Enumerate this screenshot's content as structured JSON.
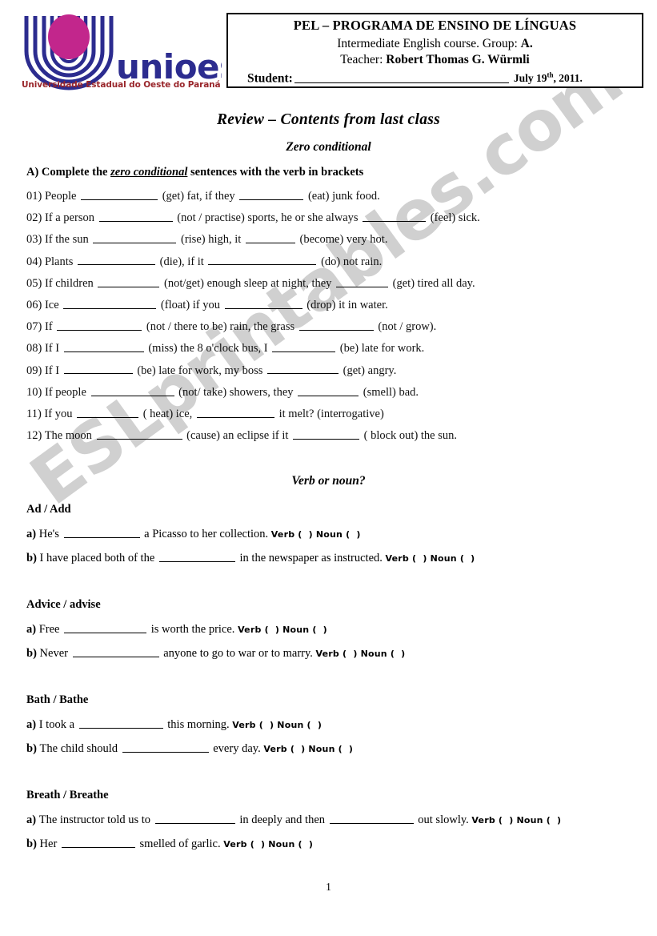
{
  "logo": {
    "wordmark": "unioeste",
    "subtitle": "Universidade Estadual do Oeste do Paraná",
    "colors": {
      "arcs": "#2c2c8f",
      "ellipse": "#c2268c",
      "wordmark": "#2c2c8f",
      "subtitle": "#99262b"
    }
  },
  "header": {
    "line1": "PEL – PROGRAMA DE ENSINO DE LÍNGUAS",
    "line2_prefix": "Intermediate English course. Group:",
    "line2_group": "A.",
    "line3_prefix": "Teacher:",
    "line3_name": "Robert Thomas G. Würmli",
    "student_label": "Student:",
    "date_prefix": "July 19",
    "date_sup": "th",
    "date_suffix": ", 2011."
  },
  "titles": {
    "main": "Review – Contents from last class",
    "sub": "Zero conditional",
    "verb_or_noun": "Verb or noun?"
  },
  "instruction": {
    "before": "A) Complete the ",
    "emphasis": "zero conditional",
    "after": " sentences with the verb in brackets"
  },
  "zero_conditional": [
    {
      "num": "01)",
      "parts": [
        "People",
        "(get) fat, if they",
        "(eat) junk food."
      ],
      "blanks": [
        96,
        80
      ]
    },
    {
      "num": "02)",
      "parts": [
        "If a person",
        "(not / practise) sports, he or she always",
        "(feel) sick."
      ],
      "blanks": [
        92,
        79
      ]
    },
    {
      "num": "03)",
      "parts": [
        "If the sun",
        "(rise) high, it",
        "(become) very hot."
      ],
      "blanks": [
        104,
        62
      ]
    },
    {
      "num": "04)",
      "parts": [
        "Plants",
        "(die), if it",
        "(do) not rain."
      ],
      "blanks": [
        97,
        135
      ]
    },
    {
      "num": "05)",
      "parts": [
        "If children",
        "(not/get) enough sleep at night, they",
        "(get) tired all day."
      ],
      "blanks": [
        77,
        65
      ]
    },
    {
      "num": "06)",
      "parts": [
        "Ice",
        "(float) if you",
        "(drop) it in water."
      ],
      "blanks": [
        116,
        97
      ]
    },
    {
      "num": "07)",
      "parts": [
        "If",
        "(not / there to be) rain, the grass",
        "(not / grow)."
      ],
      "blanks": [
        106,
        93
      ]
    },
    {
      "num": "08)",
      "parts": [
        "If I",
        "(miss) the 8 o'clock bus, I",
        "(be) late for work."
      ],
      "blanks": [
        100,
        79
      ]
    },
    {
      "num": "09)",
      "parts": [
        "If I",
        "(be) late for work, my boss",
        "(get) angry."
      ],
      "blanks": [
        86,
        89
      ]
    },
    {
      "num": "10)",
      "parts": [
        "If   people",
        "(not/ take) showers, they",
        "(smell) bad."
      ],
      "blanks": [
        104,
        76
      ]
    },
    {
      "num": "11)",
      "parts": [
        "If you",
        "( heat) ice,",
        "it melt? (interrogative)"
      ],
      "blanks": [
        77,
        97
      ]
    },
    {
      "num": "12)",
      "parts": [
        "The moon",
        "(cause) an eclipse if it",
        "( block out) the sun."
      ],
      "blanks": [
        107,
        83
      ]
    }
  ],
  "verb_or_noun": {
    "tag_verb": "Verb (",
    "tag_verb_close": ") Noun (",
    "tag_close": ")",
    "groups": [
      {
        "heading": "Ad / Add",
        "items": [
          {
            "bullet": "a)",
            "parts": [
              "He's",
              "a Picasso to her collection."
            ],
            "blanks": [
              95
            ]
          },
          {
            "bullet": "b)",
            "parts": [
              "I have placed both of the",
              "in the newspaper as instructed."
            ],
            "blanks": [
              95
            ]
          }
        ]
      },
      {
        "heading": "Advice / advise",
        "items": [
          {
            "bullet": "a)",
            "parts": [
              "Free",
              "is worth the price."
            ],
            "blanks": [
              103
            ]
          },
          {
            "bullet": "b)",
            "parts": [
              "Never",
              "anyone to go to war or to marry."
            ],
            "blanks": [
              108
            ]
          }
        ]
      },
      {
        "heading": "Bath / Bathe",
        "items": [
          {
            "bullet": "a)",
            "parts": [
              "I took a",
              "this morning."
            ],
            "blanks": [
              105
            ]
          },
          {
            "bullet": "b)",
            "parts": [
              "The child should",
              "every day."
            ],
            "blanks": [
              108
            ]
          }
        ]
      },
      {
        "heading": "Breath / Breathe",
        "items": [
          {
            "bullet": "a)",
            "parts": [
              "The instructor told us to",
              "in deeply and then",
              "out slowly."
            ],
            "blanks": [
              100,
              105
            ]
          },
          {
            "bullet": "b)",
            "parts": [
              "Her",
              "smelled of garlic."
            ],
            "blanks": [
              92
            ]
          }
        ]
      }
    ]
  },
  "watermark": {
    "text": "ESLprintables.com"
  },
  "footer": {
    "page_number": "1"
  }
}
